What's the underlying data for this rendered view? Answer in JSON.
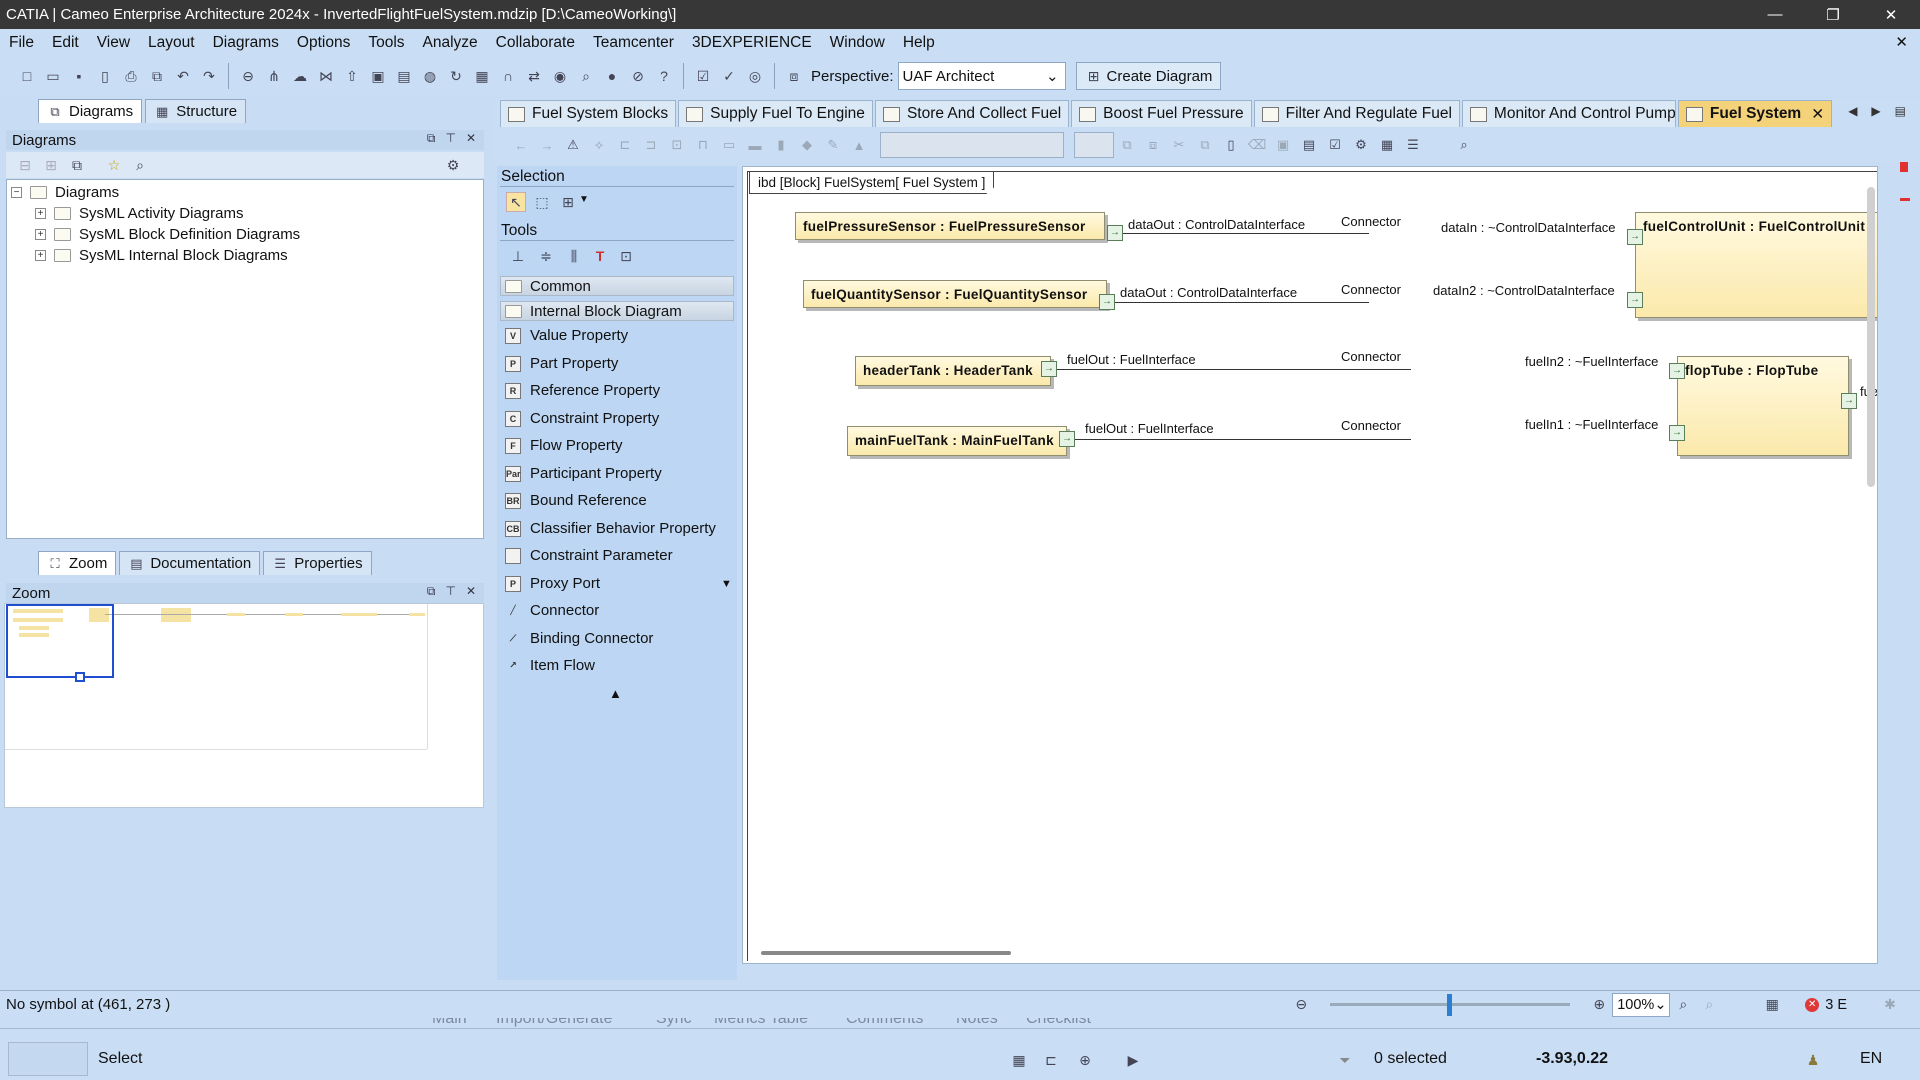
{
  "window": {
    "title": "CATIA | Cameo Enterprise Architecture 2024x - InvertedFlightFuelSystem.mdzip [D:\\CameoWorking\\]",
    "minimize": "—",
    "maximize": "❐",
    "close": "✕"
  },
  "menu": [
    "File",
    "Edit",
    "View",
    "Layout",
    "Diagrams",
    "Options",
    "Tools",
    "Analyze",
    "Collaborate",
    "Teamcenter",
    "3DEXPERIENCE",
    "Window",
    "Help"
  ],
  "menu_close": "✕",
  "toolbar": {
    "perspective_label": "Perspective:",
    "perspective_value": "UAF Architect",
    "create_diagram": "Create Diagram"
  },
  "left_top_tabs": [
    "Diagrams",
    "Structure"
  ],
  "diagrams_panel": {
    "title": "Diagrams",
    "tree": [
      {
        "label": "Diagrams",
        "expander": "−"
      },
      {
        "label": "SysML Activity Diagrams",
        "expander": "+"
      },
      {
        "label": "SysML Block Definition Diagrams",
        "expander": "+"
      },
      {
        "label": "SysML Internal Block Diagrams",
        "expander": "+"
      }
    ]
  },
  "left_bottom_tabs": [
    "Zoom",
    "Documentation",
    "Properties"
  ],
  "zoom_panel": {
    "title": "Zoom"
  },
  "palette": {
    "selection": "Selection",
    "tools": "Tools",
    "common": "Common",
    "ibd_group": "Internal Block Diagram",
    "items": [
      {
        "code": "V",
        "label": "Value Property"
      },
      {
        "code": "P",
        "label": "Part Property"
      },
      {
        "code": "R",
        "label": "Reference Property"
      },
      {
        "code": "C",
        "label": "Constraint Property"
      },
      {
        "code": "F",
        "label": "Flow Property"
      },
      {
        "code": "Par",
        "label": "Participant Property"
      },
      {
        "code": "BR",
        "label": "Bound Reference"
      },
      {
        "code": "CB",
        "label": "Classifier Behavior Property"
      },
      {
        "code": "",
        "label": "Constraint Parameter"
      },
      {
        "code": "P",
        "label": "Proxy Port"
      },
      {
        "code": "",
        "label": "Connector"
      },
      {
        "code": "",
        "label": "Binding Connector"
      },
      {
        "code": "",
        "label": "Item Flow"
      }
    ]
  },
  "diagram_tabs": [
    {
      "label": "Fuel System Blocks"
    },
    {
      "label": "Supply Fuel To Engine"
    },
    {
      "label": "Store And Collect Fuel"
    },
    {
      "label": "Boost Fuel Pressure"
    },
    {
      "label": "Filter And Regulate Fuel"
    },
    {
      "label": "Monitor And Control Pump"
    },
    {
      "label": "Fuel System"
    }
  ],
  "diagram": {
    "frame_label": "ibd [Block] FuelSystem[ Fuel System ]",
    "parts": [
      {
        "label": "fuelPressureSensor : FuelPressureSensor"
      },
      {
        "label": "fuelQuantitySensor : FuelQuantitySensor"
      },
      {
        "label": "headerTank : HeaderTank"
      },
      {
        "label": "mainFuelTank : MainFuelTank"
      },
      {
        "label": "fuelControlUnit : FuelControlUnit"
      },
      {
        "label": "flopTube : FlopTube"
      }
    ],
    "labels": {
      "p1_out": "dataOut : ControlDataInterface",
      "p2_out": "dataOut : ControlDataInterface",
      "p3_out": "fuelOut : FuelInterface",
      "p4_out": "fuelOut : FuelInterface",
      "c1": "Connector",
      "c2": "Connector",
      "c3": "Connector",
      "c4": "Connector",
      "in1": "dataIn : ~ControlDataInterface",
      "in2": "dataIn2 : ~ControlDataInterface",
      "in3": "fuelIn2 : ~FuelInterface",
      "in4": "fuelIn1 : ~FuelInterface",
      "flop_out": "fue"
    }
  },
  "status": {
    "message": "No symbol at (461, 273 )",
    "zoom": "100%",
    "errors": "3 E"
  },
  "ghost_tabs": [
    "Main",
    "Import/Generate",
    "Sync",
    "Metrics Table",
    "Comments",
    "Notes",
    "Checklist"
  ],
  "bottom": {
    "mode": "Select",
    "selected": "0 selected",
    "coords": "-3.93,0.22",
    "lang": "EN"
  }
}
